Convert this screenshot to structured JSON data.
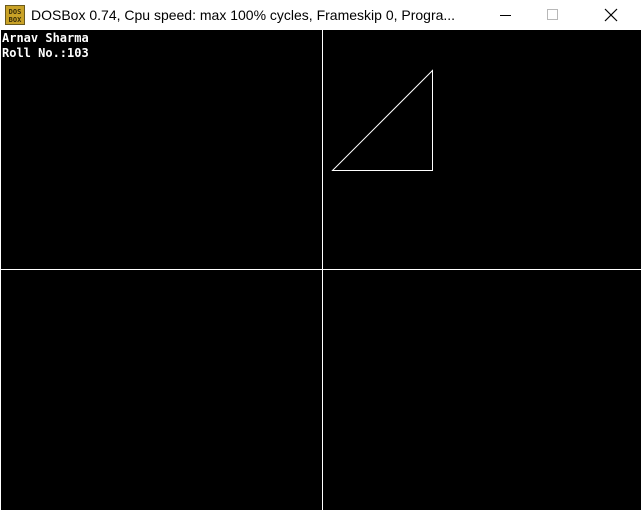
{
  "window": {
    "title": "DOSBox 0.74, Cpu speed: max 100% cycles, Frameskip  0, Progra...",
    "icon": "dosbox-icon",
    "icon_text_top": "DOS",
    "icon_text_bottom": "BOX"
  },
  "caption_buttons": {
    "minimize": "minimize-icon",
    "maximize": "maximize-icon",
    "close": "close-icon"
  },
  "screen": {
    "lines": [
      "Arnav Sharma",
      "Roll No.:103"
    ],
    "background": "#000000",
    "foreground": "#ffffff"
  }
}
